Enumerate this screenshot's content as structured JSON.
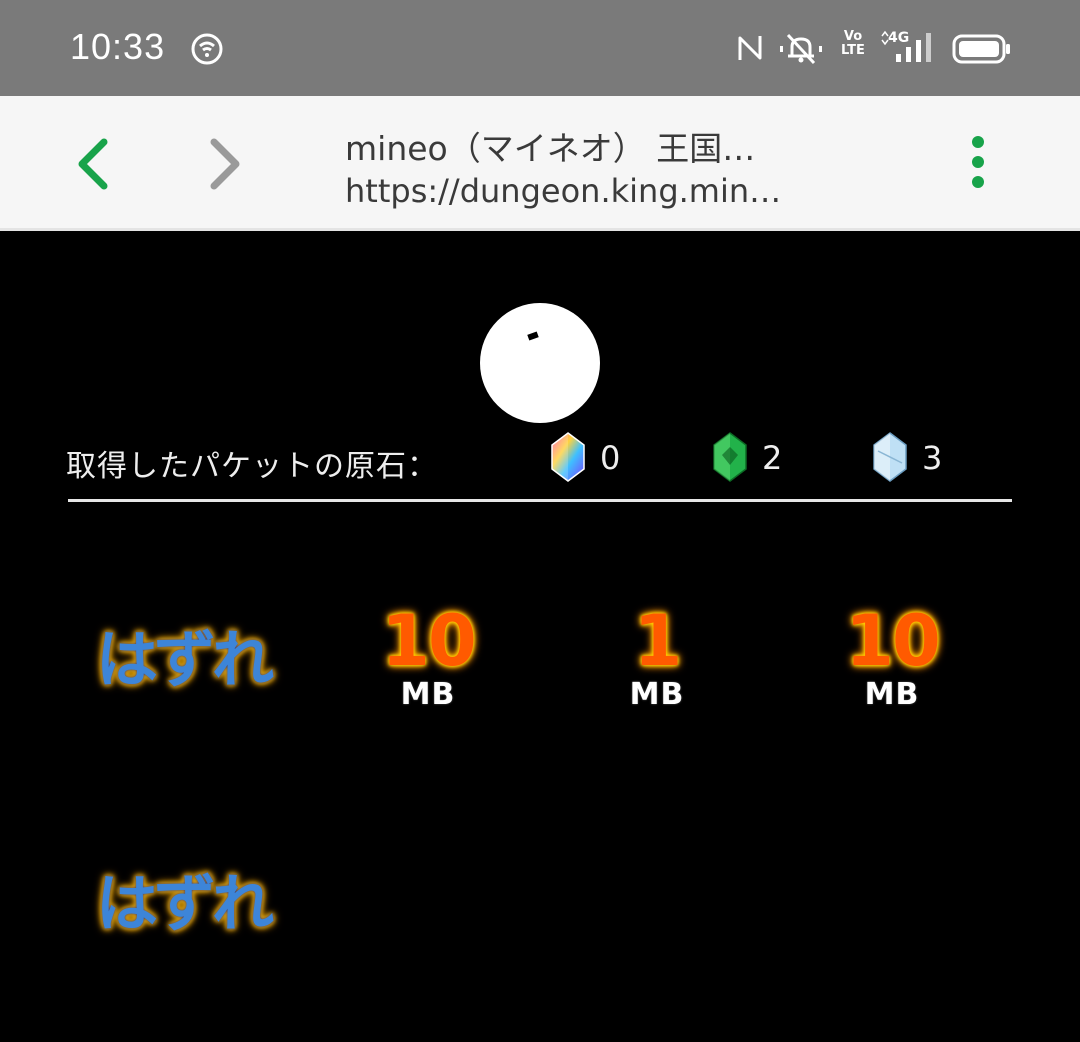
{
  "status_bar": {
    "time": "10:33",
    "icons": [
      "hotspot-icon",
      "nfc-icon",
      "silent-icon",
      "volte-icon",
      "signal-4g-icon",
      "battery-icon"
    ],
    "volte_text": "Vo LTE",
    "network_text": "4G"
  },
  "browser": {
    "title": "mineo（マイネオ） 王国…",
    "url": "https://dungeon.king.min…",
    "back_color": "#18a34a",
    "forward_color": "#9a9a9a",
    "menu_color": "#18a34a"
  },
  "game": {
    "ore_label": "取得したパケットの原石：",
    "ores": [
      {
        "name": "rainbow-ore-icon",
        "count": "0"
      },
      {
        "name": "green-ore-icon",
        "count": "2"
      },
      {
        "name": "ice-ore-icon",
        "count": "3"
      }
    ],
    "results": [
      {
        "type": "miss",
        "text": "はずれ"
      },
      {
        "type": "prize",
        "value": "10",
        "unit": "MB"
      },
      {
        "type": "prize",
        "value": "1",
        "unit": "MB"
      },
      {
        "type": "prize",
        "value": "10",
        "unit": "MB"
      },
      {
        "type": "miss",
        "text": "はずれ"
      }
    ]
  }
}
